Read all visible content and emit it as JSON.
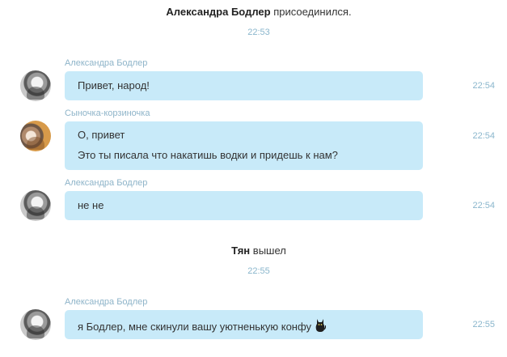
{
  "events": [
    {
      "name": "Александра Бодлер",
      "action": "присоединился.",
      "time": "22:53"
    },
    {
      "name": "Тян",
      "action": "вышел",
      "time": "22:55"
    }
  ],
  "messages": [
    {
      "sender": "Александра Бодлер",
      "lines": [
        "Привет, народ!"
      ],
      "time": "22:54",
      "avatar": "gray-photo-avatar"
    },
    {
      "sender": "Сыночка-корзиночка",
      "lines": [
        "О, привет",
        "Это ты писала что накатишь водки и придешь к нам?"
      ],
      "time": "22:54",
      "avatar": "warm-photo-avatar"
    },
    {
      "sender": "Александра Бодлер",
      "lines": [
        "не не"
      ],
      "time": "22:54",
      "avatar": "gray-photo-avatar"
    },
    {
      "sender": "Александра Бодлер",
      "lines": [
        "я Бодлер, мне скинули вашу уютненькую конфу"
      ],
      "time": "22:55",
      "avatar": "gray-photo-avatar",
      "emoji": "black-cat-emoji"
    }
  ],
  "colors": {
    "bubble": "#c8eaf9",
    "sender_name": "#8eb4c9",
    "timestamp": "#8ab6cc",
    "text": "#333333"
  }
}
